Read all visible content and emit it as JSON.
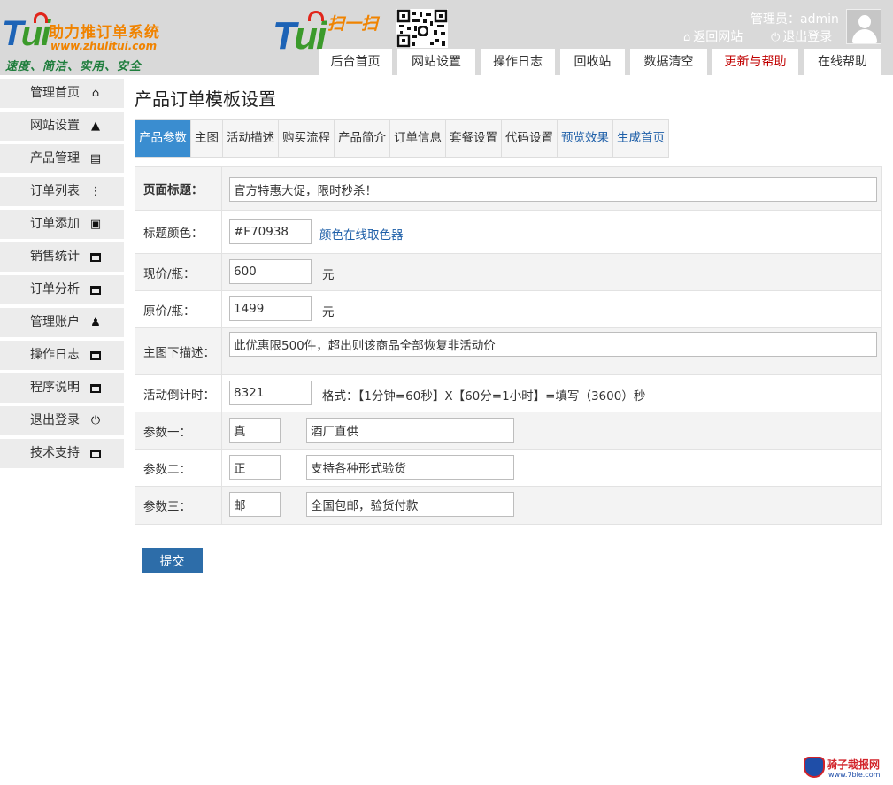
{
  "header": {
    "logo_name": "助力推订单系统",
    "logo_url": "www.zhulitui.com",
    "logo_slogan": "速度、简洁、实用、安全",
    "logo_mark": "tui",
    "scan_label": "扫一扫",
    "admin_label": "管理员：",
    "admin_user": "admin",
    "back_site": "返回网站",
    "logout": "退出登录"
  },
  "top_nav": [
    {
      "label": "后台首页"
    },
    {
      "label": "网站设置"
    },
    {
      "label": "操作日志"
    },
    {
      "label": "回收站"
    },
    {
      "label": "数据清空"
    },
    {
      "label": "更新与帮助"
    },
    {
      "label": "在线帮助"
    }
  ],
  "sidebar": {
    "items": [
      {
        "label": "管理首页",
        "icon": "home-icon"
      },
      {
        "label": "网站设置",
        "icon": "plug-icon"
      },
      {
        "label": "产品管理",
        "icon": "print-icon"
      },
      {
        "label": "订单列表",
        "icon": "sitemap-icon"
      },
      {
        "label": "订单添加",
        "icon": "file-check-icon"
      },
      {
        "label": "销售统计",
        "icon": "window-icon"
      },
      {
        "label": "订单分析",
        "icon": "window-icon"
      },
      {
        "label": "管理账户",
        "icon": "user-icon"
      },
      {
        "label": "操作日志",
        "icon": "window-icon"
      },
      {
        "label": "程序说明",
        "icon": "window-icon"
      },
      {
        "label": "退出登录",
        "icon": "power-icon"
      },
      {
        "label": "技术支持",
        "icon": "window-icon"
      }
    ]
  },
  "main": {
    "title": "产品订单模板设置",
    "tabs": [
      {
        "label": "产品参数"
      },
      {
        "label": "主图"
      },
      {
        "label": "活动描述"
      },
      {
        "label": "购买流程"
      },
      {
        "label": "产品简介"
      },
      {
        "label": "订单信息"
      },
      {
        "label": "套餐设置"
      },
      {
        "label": "代码设置"
      },
      {
        "label": "预览效果"
      },
      {
        "label": "生成首页"
      }
    ],
    "form": {
      "page_title_label": "页面标题：",
      "page_title_value": "官方特惠大促，限时秒杀！",
      "title_color_label": "标题颜色：",
      "title_color_value": "#F70938",
      "color_picker_link": "颜色在线取色器",
      "current_price_label": "现价/瓶：",
      "current_price_value": "600",
      "current_price_unit": "元",
      "original_price_label": "原价/瓶：",
      "original_price_value": "1499",
      "original_price_unit": "元",
      "main_desc_label": "主图下描述：",
      "main_desc_value": "此优惠限500件，超出则该商品全部恢复非活动价",
      "countdown_label": "活动倒计时：",
      "countdown_value": "8321",
      "countdown_hint": "格式：【1分钟=60秒】X【60分=1小时】=填写（3600）秒",
      "param1_label": "参数一：",
      "param1_key": "真",
      "param1_value": "酒厂直供",
      "param2_label": "参数二：",
      "param2_key": "正",
      "param2_value": "支持各种形式验货",
      "param3_label": "参数三：",
      "param3_key": "邮",
      "param3_value": "全国包邮，验货付款"
    },
    "submit_label": "提交"
  },
  "watermark": {
    "title": "骑子栽报网",
    "url": "www.7bie.com"
  },
  "colors": {
    "header_bg": "#d9d9d9",
    "active_tab": "#3a8dd0",
    "submit_bg": "#2d6da9",
    "link": "#1e5fa8",
    "nav_red": "#c00000"
  }
}
